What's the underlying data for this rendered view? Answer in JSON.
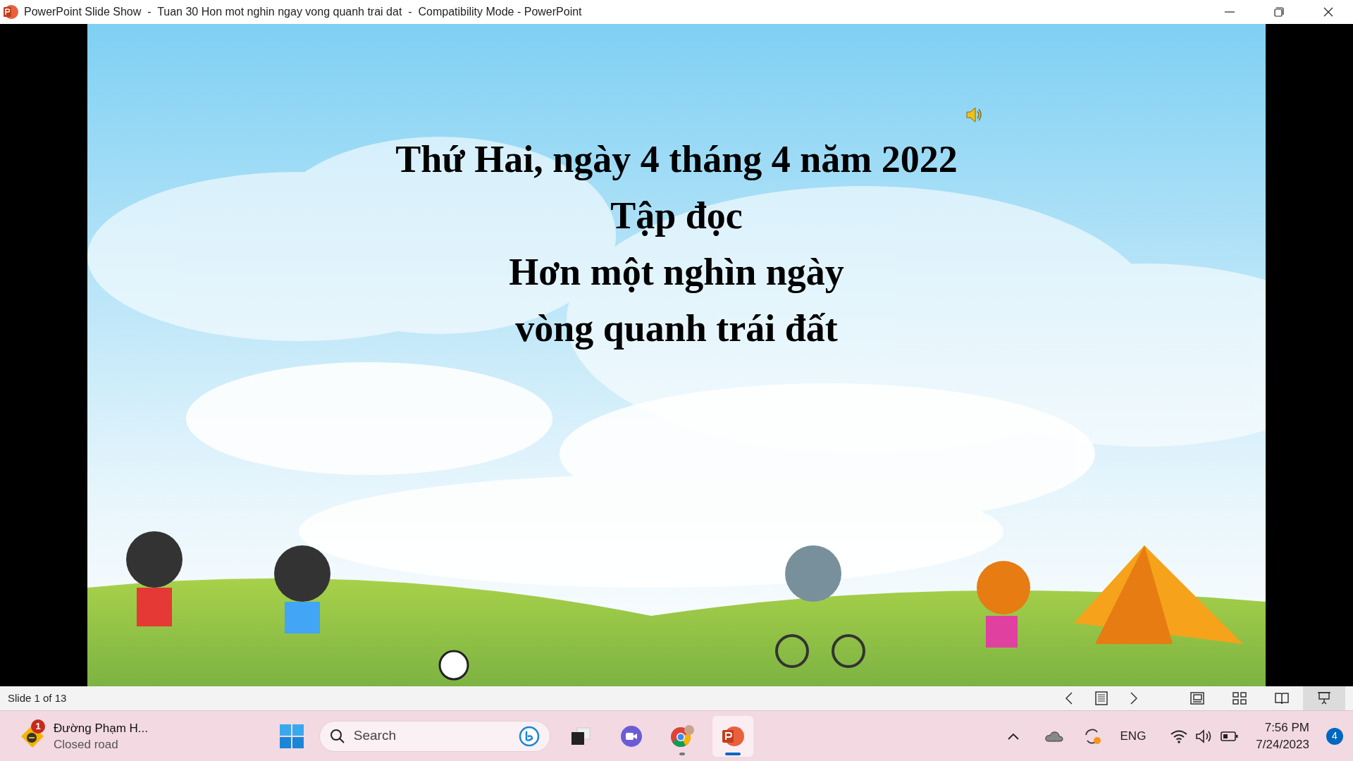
{
  "window": {
    "title": "PowerPoint Slide Show  -  Tuan 30 Hon mot nghin ngay vong quanh trai dat  -  Compatibility Mode - PowerPoint"
  },
  "slide": {
    "lines": [
      "Thứ Hai, ngày 4 tháng 4 năm 2022",
      "Tập đọc",
      "Hơn một nghìn ngày",
      "vòng quanh trái đất"
    ]
  },
  "status_bar": {
    "slide_counter": "Slide 1 of 13",
    "views": [
      {
        "kind": "normal",
        "selected": false
      },
      {
        "kind": "sorter",
        "selected": false
      },
      {
        "kind": "reading",
        "selected": false
      },
      {
        "kind": "slideshow",
        "selected": true
      }
    ]
  },
  "taskbar": {
    "widget": {
      "badge": "1",
      "title": "Đường Phạm H...",
      "subtitle": "Closed road"
    },
    "search": {
      "placeholder": "Search"
    },
    "apps": [
      {
        "kind": "taskview",
        "selected": false
      },
      {
        "kind": "meet",
        "selected": false
      },
      {
        "kind": "browser",
        "selected": false,
        "running": true
      },
      {
        "kind": "powerpoint",
        "selected": true,
        "running": true
      }
    ],
    "language": "ENG",
    "time": "7:56 PM",
    "date": "7/24/2023",
    "notifications": "4"
  }
}
